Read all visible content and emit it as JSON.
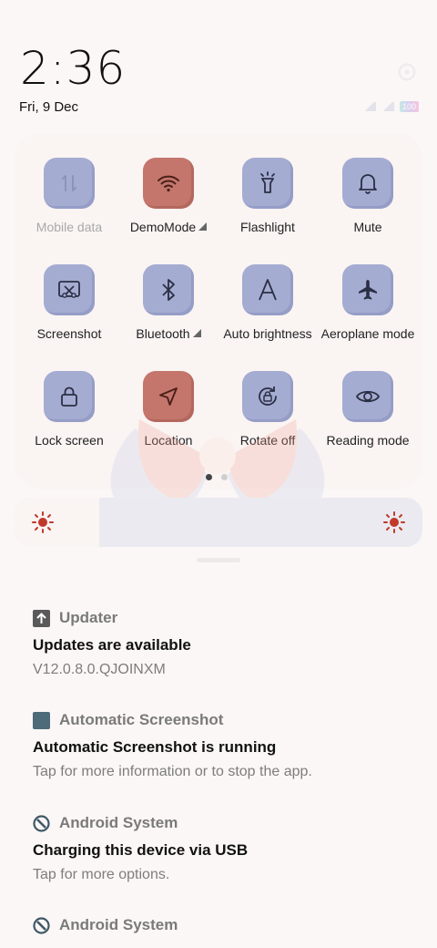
{
  "header": {
    "time": "2:36",
    "date": "Fri, 9 Dec",
    "battery": "100"
  },
  "tiles": [
    {
      "label": "Mobile data",
      "icon": "mobile-data-icon",
      "state": "disabled"
    },
    {
      "label": "DemoMode",
      "icon": "wifi-icon",
      "state": "on",
      "expand": true
    },
    {
      "label": "Flashlight",
      "icon": "flashlight-icon",
      "state": "off"
    },
    {
      "label": "Mute",
      "icon": "bell-icon",
      "state": "off"
    },
    {
      "label": "Screenshot",
      "icon": "screenshot-icon",
      "state": "off"
    },
    {
      "label": "Bluetooth",
      "icon": "bluetooth-icon",
      "state": "off",
      "expand": true
    },
    {
      "label": "Auto brightness",
      "icon": "auto-brightness-icon",
      "state": "off"
    },
    {
      "label": "Aeroplane mode",
      "icon": "aeroplane-icon",
      "state": "off"
    },
    {
      "label": "Lock screen",
      "icon": "lock-icon",
      "state": "off"
    },
    {
      "label": "Location",
      "icon": "location-icon",
      "state": "on"
    },
    {
      "label": "Rotate off",
      "icon": "rotate-lock-icon",
      "state": "off"
    },
    {
      "label": "Reading mode",
      "icon": "eye-icon",
      "state": "off"
    }
  ],
  "pager": {
    "pages": 2,
    "current": 1
  },
  "brightness": {
    "level": 0.2
  },
  "notifications": [
    {
      "app": "Updater",
      "icon": "upload-arrow-icon",
      "title": "Updates are available",
      "body": "V12.0.8.0.QJOINXM"
    },
    {
      "app": "Automatic Screenshot",
      "icon": "screenshot-app-icon",
      "title": "Automatic Screenshot is running",
      "body": "Tap for more information or to stop the app."
    },
    {
      "app": "Android System",
      "icon": "android-system-icon",
      "title": "Charging this device via USB",
      "body": "Tap for more options."
    },
    {
      "app": "Android System",
      "icon": "android-system-icon",
      "title": "",
      "body": ""
    }
  ],
  "colors": {
    "tile_off": "#a5acd1",
    "tile_on": "#c4766c",
    "accent_sun": "#c0392b"
  }
}
